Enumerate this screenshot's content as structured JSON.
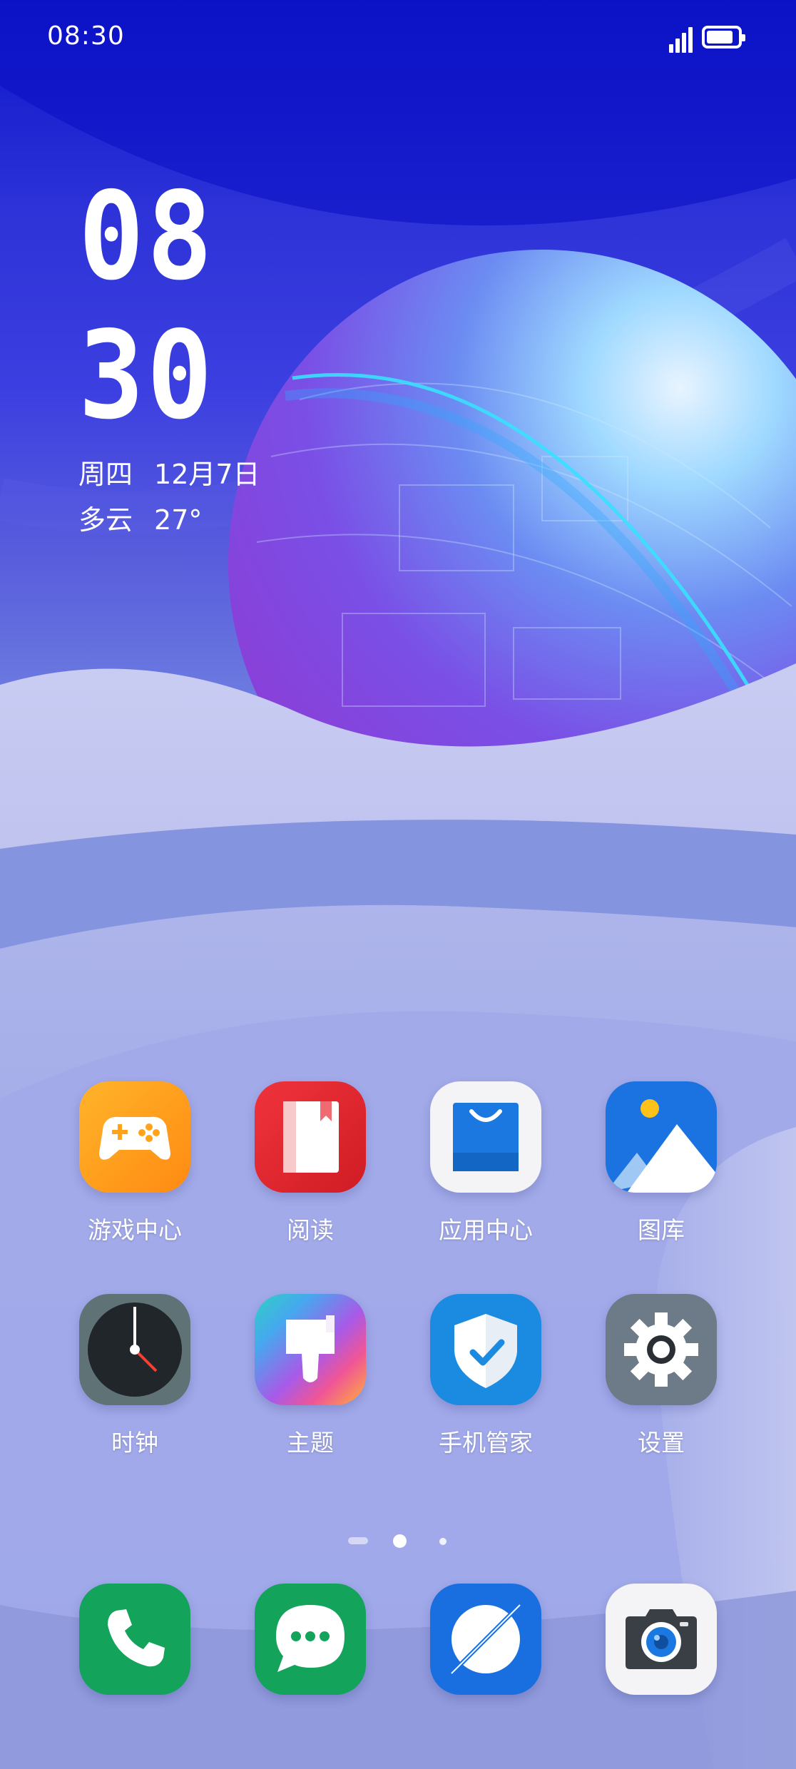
{
  "status_bar": {
    "time": "08:30",
    "signal_icon": "signal-icon",
    "battery_icon": "battery-icon",
    "battery_level": 0.75
  },
  "clock_widget": {
    "hour": "08",
    "minute": "30",
    "weekday": "周四",
    "date": "12月7日",
    "weather": "多云",
    "temperature": "27°"
  },
  "apps": [
    {
      "label": "游戏中心",
      "icon": "game-controller-icon",
      "color": "#ff9a1e"
    },
    {
      "label": "阅读",
      "icon": "book-icon",
      "color": "#e6262f"
    },
    {
      "label": "应用中心",
      "icon": "shopping-bag-icon",
      "color": "#f4f4f6"
    },
    {
      "label": "图库",
      "icon": "gallery-icon",
      "color": "#1a73e0"
    },
    {
      "label": "时钟",
      "icon": "clock-icon",
      "color": "#5f7376"
    },
    {
      "label": "主题",
      "icon": "paintbrush-icon",
      "color": "#c64ad8"
    },
    {
      "label": "手机管家",
      "icon": "shield-icon",
      "color": "#1a8be0"
    },
    {
      "label": "设置",
      "icon": "gear-icon",
      "color": "#6d7a88"
    }
  ],
  "page_indicator": {
    "pages": 3,
    "current": 2
  },
  "dock": [
    {
      "icon": "phone-icon",
      "color": "#13a35a"
    },
    {
      "icon": "message-icon",
      "color": "#13a35a"
    },
    {
      "icon": "browser-icon",
      "color": "#1a6fe0"
    },
    {
      "icon": "camera-icon",
      "color": "#f4f4f6"
    }
  ]
}
